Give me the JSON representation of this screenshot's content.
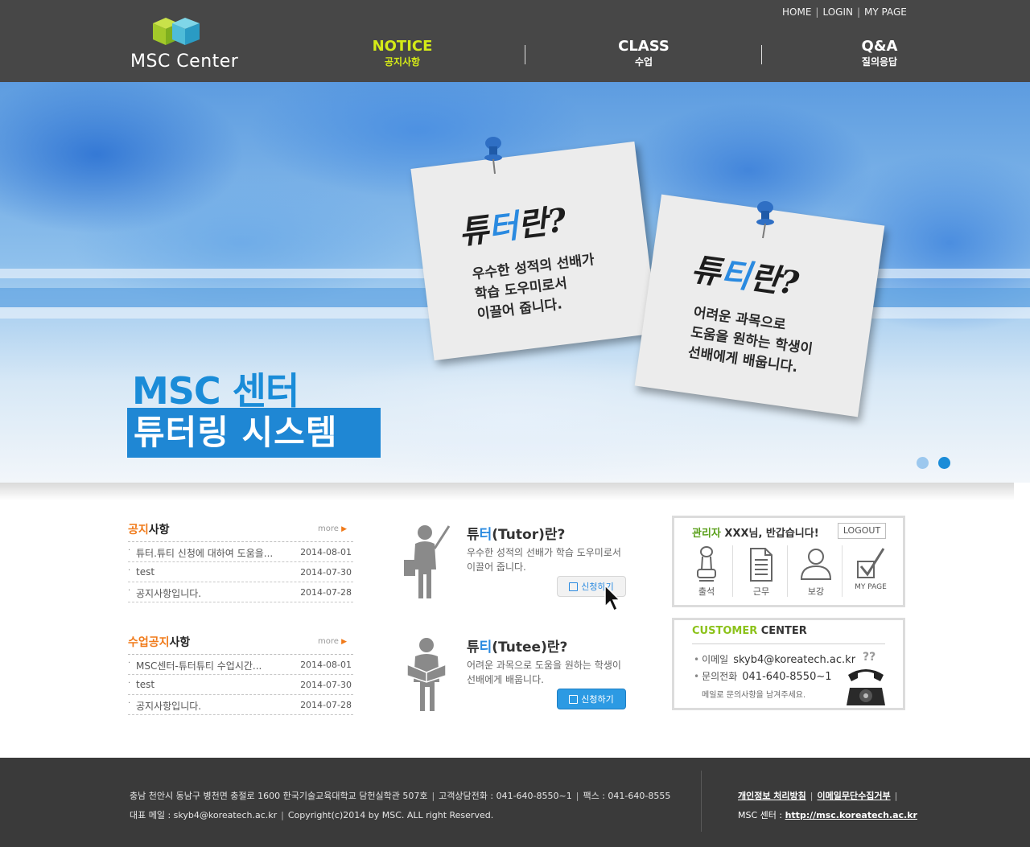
{
  "header": {
    "util_links": [
      "HOME",
      "LOGIN",
      "MY PAGE"
    ],
    "logo_text": "MSC Center",
    "nav": [
      {
        "en": "NOTICE",
        "ko": "공지사항",
        "active": true
      },
      {
        "en": "CLASS",
        "ko": "수업",
        "active": false
      },
      {
        "en": "Q&A",
        "ko": "질의응답",
        "active": false
      }
    ],
    "active_color": "#d4ea17",
    "bg_color": "#474747"
  },
  "hero": {
    "note1": {
      "title_a": "튜",
      "title_hl": "터",
      "title_b": "란?",
      "lines": [
        "우수한 성적의 선배가",
        "학습 도우미로서",
        "이끌어 줍니다."
      ]
    },
    "note2": {
      "title_a": "튜",
      "title_hl": "티",
      "title_b": "란?",
      "lines": [
        "어려운 과목으로",
        "도움을 원하는 학생이",
        "선배에게 배웁니다."
      ]
    },
    "title1": "MSC 센터",
    "title2": "튜터링 시스템",
    "slide_count": 2,
    "active_slide": 2
  },
  "boards": {
    "notice": {
      "title_hl": "공지",
      "title_rest": "사항",
      "more": "more",
      "rows": [
        {
          "title": "튜터.튜티 신청에 대하여 도움을...",
          "date": "2014-08-01"
        },
        {
          "title": "test",
          "date": "2014-07-30"
        },
        {
          "title": "공지사항입니다.",
          "date": "2014-07-28"
        }
      ]
    },
    "class_notice": {
      "title_hl": "수업공지",
      "title_rest": "사항",
      "more": "more",
      "rows": [
        {
          "title": "MSC센터-튜터튜티 수업시간...",
          "date": "2014-08-01"
        },
        {
          "title": "test",
          "date": "2014-07-30"
        },
        {
          "title": "공지사항입니다.",
          "date": "2014-07-28"
        }
      ]
    }
  },
  "tutor": {
    "title_a": "튜",
    "title_hl": "터",
    "title_b": "(Tutor)란?",
    "desc": [
      "우수한 성적의 선배가 학습 도우미로서",
      "이끌어 줍니다."
    ],
    "button": "신청하기"
  },
  "tutee": {
    "title_a": "튜",
    "title_hl": "티",
    "title_b": "(Tutee)란?",
    "desc": [
      "어려운 과목으로 도움을 원하는 학생이",
      "선배에게 배웁니다."
    ],
    "button": "신청하기"
  },
  "login_box": {
    "welcome_hl": "관리자",
    "welcome_rest": "XXX님, 반갑습니다!",
    "logout": "LOGOUT",
    "menu": [
      {
        "label": "출석",
        "icon": "stamp-icon"
      },
      {
        "label": "근무",
        "icon": "document-icon"
      },
      {
        "label": "보강",
        "icon": "person-icon"
      },
      {
        "label": "MY PAGE",
        "icon": "checkmark-icon"
      }
    ]
  },
  "customer_center": {
    "title_hl": "CUSTOMER",
    "title_rest": "CENTER",
    "email_label": "이메일",
    "email": "skyb4@koreatech.ac.kr",
    "phone_label": "문의전화",
    "phone": "041-640-8550~1",
    "note": "메일로 문의사항을 남겨주세요.",
    "question_marks": "??"
  },
  "footer": {
    "address": "충남 천안시 동남구 병천면 충절로 1600 한국기술교육대학교 담헌실학관 507호",
    "consult": "고객상담전화 : 041-640-8550~1",
    "fax": "팩스 : 041-640-8555",
    "email": "대표 메일 : skyb4@koreatech.ac.kr",
    "copyright": "Copyright(c)2014 by MSC. ALL right Reserved.",
    "privacy": "개인정보 처리방침",
    "email_refusal": "이메일무단수집거부",
    "site_label": "MSC 센터 :",
    "site_url": "http://msc.koreatech.ac.kr"
  }
}
